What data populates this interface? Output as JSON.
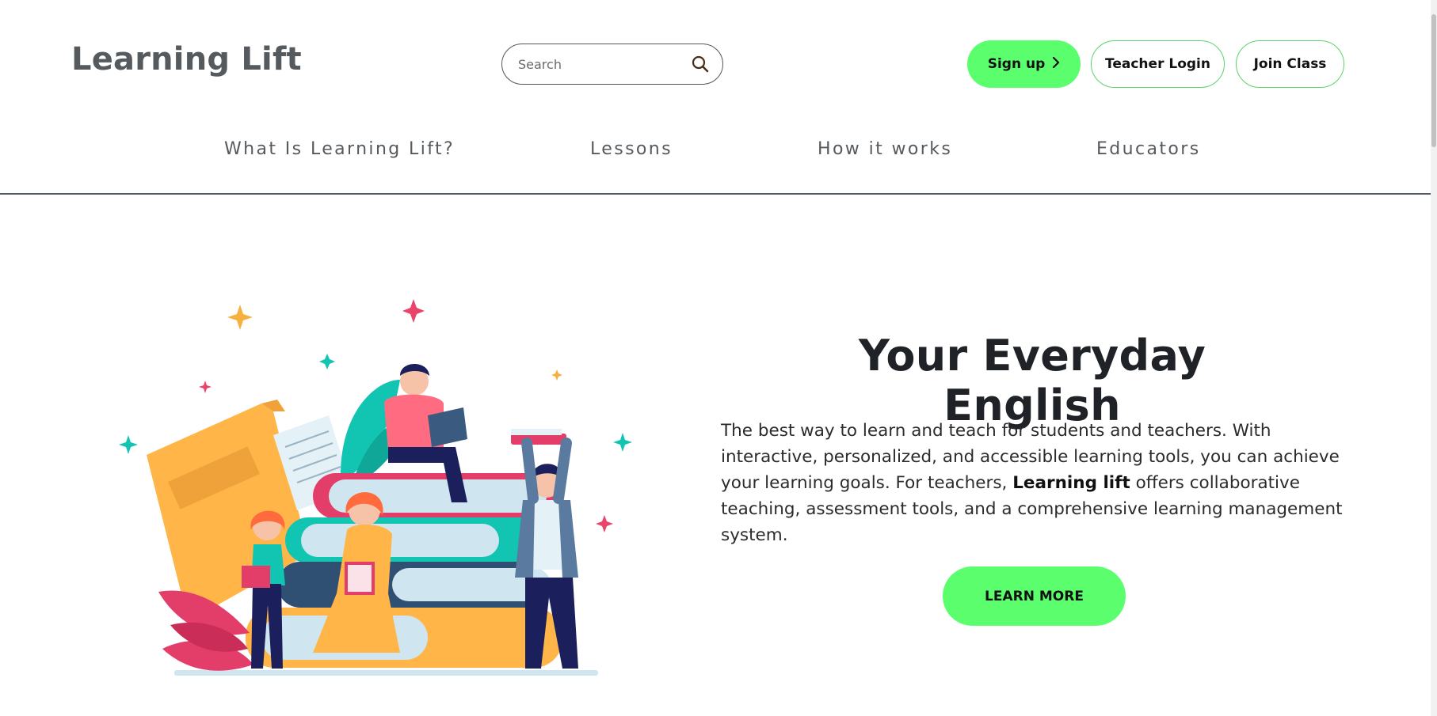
{
  "header": {
    "brand": "Learning Lift",
    "search": {
      "placeholder": "Search"
    },
    "buttons": {
      "signup": "Sign up",
      "teacher_login": "Teacher Login",
      "join_class": "Join Class"
    }
  },
  "nav": {
    "items": [
      {
        "label": "What Is Learning Lift?"
      },
      {
        "label": "Lessons"
      },
      {
        "label": "How it works"
      },
      {
        "label": "Educators"
      }
    ]
  },
  "hero": {
    "title": "Your Everyday English",
    "text_before": "The best way to learn and teach for students and teachers. With interactive, personalized, and accessible learning tools, you can achieve your learning goals. For teachers, ",
    "text_bold": "Learning lift",
    "text_after": " offers collaborative teaching, assessment tools, and a comprehensive learning management system.",
    "cta": "LEARN MORE"
  },
  "icons": {
    "search": "search-icon",
    "signup_arrow": "chevron-right-icon"
  },
  "colors": {
    "accent_green": "#5bff6e",
    "outline_green": "#5bd46a",
    "text_gray": "#555a5f",
    "divider": "#505a66"
  }
}
